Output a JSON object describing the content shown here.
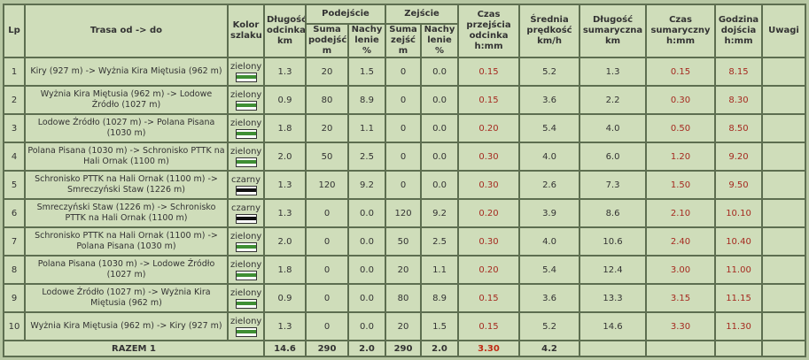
{
  "header": {
    "lp": "Lp",
    "trasa": "Trasa od -> do",
    "kolor": "Kolor szlaku",
    "dlugosc": "Długość odcinka km",
    "podejscie": "Podejście",
    "zejscie": "Zejście",
    "suma_podejsc": "Suma podejść m",
    "nachylenie": "Nachy lenie %",
    "suma_zejsc": "Suma zejść m",
    "czas_przejscia": "Czas przejścia odcinka h:mm",
    "srednia": "Średnia prędkość km/h",
    "dlugosc_sum": "Długość sumaryczna km",
    "czas_sum": "Czas sumaryczny h:mm",
    "godzina": "Godzina dojścia h:mm",
    "uwagi": "Uwagi"
  },
  "colors": {
    "zielony": "#3f8f34",
    "czarny": "#111111"
  },
  "rows": [
    {
      "lp": "1",
      "trasa": "Kiry (927 m) -> Wyżnia Kira Miętusia (962 m)",
      "kolor": "zielony",
      "swatch": "zielony",
      "dlugosc": "1.3",
      "pod_suma": "20",
      "pod_nach": "1.5",
      "zej_suma": "0",
      "zej_nach": "0.0",
      "czas": "0.15",
      "predkosc": "5.2",
      "dl_sum": "1.3",
      "czas_sum": "0.15",
      "godzina": "8.15",
      "uwagi": ""
    },
    {
      "lp": "2",
      "trasa": "Wyżnia Kira Miętusia (962 m) -> Lodowe Źródło (1027 m)",
      "kolor": "zielony",
      "swatch": "zielony",
      "dlugosc": "0.9",
      "pod_suma": "80",
      "pod_nach": "8.9",
      "zej_suma": "0",
      "zej_nach": "0.0",
      "czas": "0.15",
      "predkosc": "3.6",
      "dl_sum": "2.2",
      "czas_sum": "0.30",
      "godzina": "8.30",
      "uwagi": ""
    },
    {
      "lp": "3",
      "trasa": "Lodowe Źródło (1027 m) -> Polana Pisana (1030 m)",
      "kolor": "zielony",
      "swatch": "zielony",
      "dlugosc": "1.8",
      "pod_suma": "20",
      "pod_nach": "1.1",
      "zej_suma": "0",
      "zej_nach": "0.0",
      "czas": "0.20",
      "predkosc": "5.4",
      "dl_sum": "4.0",
      "czas_sum": "0.50",
      "godzina": "8.50",
      "uwagi": ""
    },
    {
      "lp": "4",
      "trasa": "Polana Pisana (1030 m) -> Schronisko PTTK na Hali Ornak (1100 m)",
      "kolor": "zielony",
      "swatch": "zielony",
      "dlugosc": "2.0",
      "pod_suma": "50",
      "pod_nach": "2.5",
      "zej_suma": "0",
      "zej_nach": "0.0",
      "czas": "0.30",
      "predkosc": "4.0",
      "dl_sum": "6.0",
      "czas_sum": "1.20",
      "godzina": "9.20",
      "uwagi": ""
    },
    {
      "lp": "5",
      "trasa": "Schronisko PTTK na Hali Ornak (1100 m) -> Smreczyński Staw (1226 m)",
      "kolor": "czarny",
      "swatch": "czarny",
      "dlugosc": "1.3",
      "pod_suma": "120",
      "pod_nach": "9.2",
      "zej_suma": "0",
      "zej_nach": "0.0",
      "czas": "0.30",
      "predkosc": "2.6",
      "dl_sum": "7.3",
      "czas_sum": "1.50",
      "godzina": "9.50",
      "uwagi": ""
    },
    {
      "lp": "6",
      "trasa": "Smreczyński Staw (1226 m) -> Schronisko PTTK na Hali Ornak (1100 m)",
      "kolor": "czarny",
      "swatch": "czarny",
      "dlugosc": "1.3",
      "pod_suma": "0",
      "pod_nach": "0.0",
      "zej_suma": "120",
      "zej_nach": "9.2",
      "czas": "0.20",
      "predkosc": "3.9",
      "dl_sum": "8.6",
      "czas_sum": "2.10",
      "godzina": "10.10",
      "uwagi": ""
    },
    {
      "lp": "7",
      "trasa": "Schronisko PTTK na Hali Ornak (1100 m) -> Polana Pisana (1030 m)",
      "kolor": "zielony",
      "swatch": "zielony",
      "dlugosc": "2.0",
      "pod_suma": "0",
      "pod_nach": "0.0",
      "zej_suma": "50",
      "zej_nach": "2.5",
      "czas": "0.30",
      "predkosc": "4.0",
      "dl_sum": "10.6",
      "czas_sum": "2.40",
      "godzina": "10.40",
      "uwagi": ""
    },
    {
      "lp": "8",
      "trasa": "Polana Pisana (1030 m) -> Lodowe Źródło (1027 m)",
      "kolor": "zielony",
      "swatch": "zielony",
      "dlugosc": "1.8",
      "pod_suma": "0",
      "pod_nach": "0.0",
      "zej_suma": "20",
      "zej_nach": "1.1",
      "czas": "0.20",
      "predkosc": "5.4",
      "dl_sum": "12.4",
      "czas_sum": "3.00",
      "godzina": "11.00",
      "uwagi": ""
    },
    {
      "lp": "9",
      "trasa": "Lodowe Źródło (1027 m) -> Wyżnia Kira Miętusia (962 m)",
      "kolor": "zielony",
      "swatch": "zielony",
      "dlugosc": "0.9",
      "pod_suma": "0",
      "pod_nach": "0.0",
      "zej_suma": "80",
      "zej_nach": "8.9",
      "czas": "0.15",
      "predkosc": "3.6",
      "dl_sum": "13.3",
      "czas_sum": "3.15",
      "godzina": "11.15",
      "uwagi": ""
    },
    {
      "lp": "10",
      "trasa": "Wyżnia Kira Miętusia (962 m) -> Kiry (927 m)",
      "kolor": "zielony",
      "swatch": "zielony",
      "dlugosc": "1.3",
      "pod_suma": "0",
      "pod_nach": "0.0",
      "zej_suma": "20",
      "zej_nach": "1.5",
      "czas": "0.15",
      "predkosc": "5.2",
      "dl_sum": "14.6",
      "czas_sum": "3.30",
      "godzina": "11.30",
      "uwagi": ""
    }
  ],
  "summary": {
    "label": "RAZEM 1",
    "dlugosc": "14.6",
    "pod_suma": "290",
    "pod_nach": "2.0",
    "zej_suma": "290",
    "zej_nach": "2.0",
    "czas": "3.30",
    "predkosc": "4.2"
  }
}
